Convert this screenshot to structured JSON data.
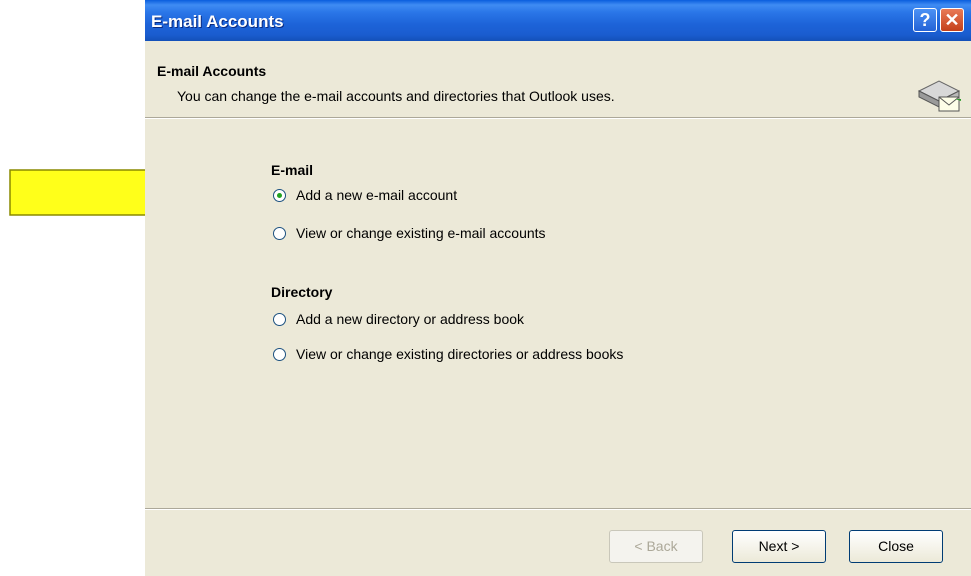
{
  "window": {
    "title": "E-mail Accounts",
    "help_label": "?",
    "close_label": "✕"
  },
  "header": {
    "title": "E-mail Accounts",
    "subtitle": "You can change the e-mail accounts and directories that Outlook uses.",
    "icon": "mail-server-icon"
  },
  "email_section": {
    "title": "E-mail",
    "options": [
      {
        "label": "Add a new e-mail account",
        "checked": true
      },
      {
        "label": "View or change existing e-mail accounts",
        "checked": false
      }
    ]
  },
  "directory_section": {
    "title": "Directory",
    "options": [
      {
        "label": "Add a new directory or address book",
        "checked": false
      },
      {
        "label": "View or change existing directories or address books",
        "checked": false
      }
    ]
  },
  "buttons": {
    "back": "< Back",
    "next": "Next >",
    "close": "Close"
  },
  "annotation": {
    "arrow_color": "#ffff00"
  }
}
